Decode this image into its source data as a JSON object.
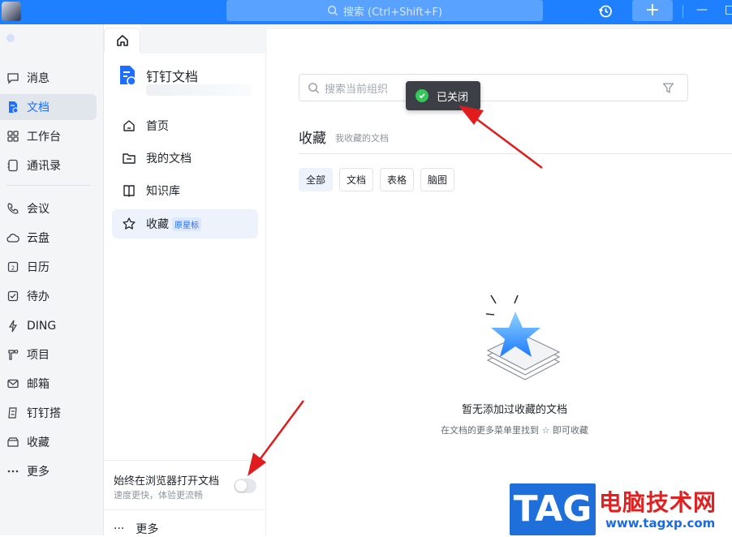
{
  "topbar": {
    "search_placeholder": "搜索 (Ctrl+Shift+F)",
    "plus_label": "+"
  },
  "leftnav": {
    "items": [
      {
        "label": "消息",
        "icon": "message-icon"
      },
      {
        "label": "文档",
        "icon": "document-icon",
        "active": true
      },
      {
        "label": "工作台",
        "icon": "grid-icon"
      },
      {
        "label": "通讯录",
        "icon": "contacts-icon"
      },
      {
        "label": "会议",
        "icon": "phone-icon"
      },
      {
        "label": "云盘",
        "icon": "cloud-icon"
      },
      {
        "label": "日历",
        "icon": "calendar-icon"
      },
      {
        "label": "待办",
        "icon": "todo-icon"
      },
      {
        "label": "DING",
        "icon": "lightning-icon"
      },
      {
        "label": "项目",
        "icon": "project-icon"
      },
      {
        "label": "邮箱",
        "icon": "mail-icon"
      },
      {
        "label": "钉钉搭",
        "icon": "build-icon"
      },
      {
        "label": "收藏",
        "icon": "favorite-box-icon"
      },
      {
        "label": "更多",
        "icon": "more-dots-icon"
      }
    ]
  },
  "midpanel": {
    "app_title": "钉钉文档",
    "items": [
      {
        "label": "首页"
      },
      {
        "label": "我的文档"
      },
      {
        "label": "知识库"
      },
      {
        "label": "收藏",
        "badge": "原星标",
        "active": true
      }
    ],
    "browser_toggle_title": "始终在浏览器打开文档",
    "browser_toggle_sub": "速度更快，体验更流畅",
    "browser_toggle_on": false,
    "more_label": "更多"
  },
  "main": {
    "org_search_placeholder": "搜索当前组织",
    "toast_text": "已关闭",
    "section_title": "收藏",
    "section_sub": "我收藏的文档",
    "filters": [
      "全部",
      "文档",
      "表格",
      "脑图"
    ],
    "active_filter": "全部",
    "empty_title": "暂无添加过收藏的文档",
    "empty_hint_before": "在文档的更多菜单里找到",
    "empty_hint_after": "即可收藏"
  },
  "watermark": {
    "tag": "TAG",
    "title": "电脑技术网",
    "url": "www.tagxp.com"
  },
  "colors": {
    "topbar": "#1e80ff",
    "accent": "#1e6fff",
    "toast_bg": "#3c3f45",
    "arrow": "#e01c1c"
  }
}
